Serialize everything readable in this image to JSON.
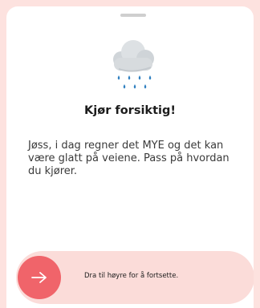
{
  "sheet": {
    "title": "Kjør forsiktig!",
    "message": "Jøss, i dag regner det MYE og det kan være glatt på veiene. Pass på hvordan du kjører.",
    "icon": "rain-cloud-icon"
  },
  "slider": {
    "label": "Dra til høyre for å fortsette.",
    "handle_icon": "arrow-right-icon"
  },
  "colors": {
    "background": "#fde2df",
    "accent": "#f0646a",
    "slider_track": "#fbdcd9",
    "raindrop": "#2f7fc0",
    "cloud": "#d9dde0"
  }
}
